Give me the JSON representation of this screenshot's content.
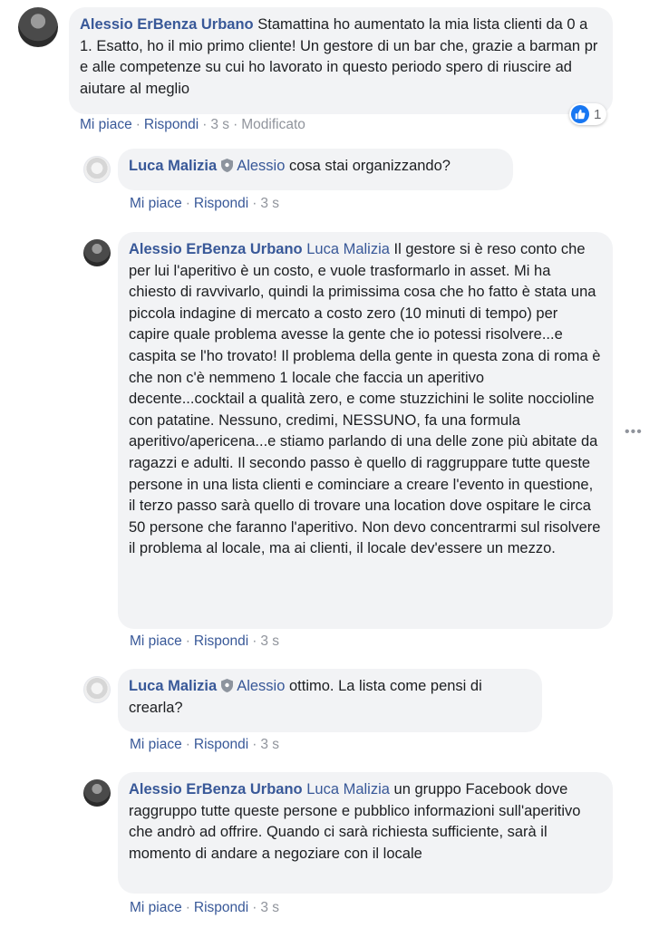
{
  "comments": [
    {
      "author": "Alessio ErBenza Urbano",
      "tag": "",
      "text": "Stamattina ho aumentato la mia lista clienti da 0 a 1. Esatto, ho il mio primo cliente! Un gestore di un bar che, grazie a barman pr e alle competenze su cui ho lavorato in questo periodo spero di riuscire ad aiutare al meglio",
      "like_label": "Mi piace",
      "reply_label": "Rispondi",
      "time": "3 s",
      "edited": "Modificato",
      "reaction_count": "1"
    },
    {
      "author": "Luca Malizia",
      "tag": "Alessio",
      "text": "cosa stai organizzando?",
      "like_label": "Mi piace",
      "reply_label": "Rispondi",
      "time": "3 s"
    },
    {
      "author": "Alessio ErBenza Urbano",
      "tag": "Luca Malizia",
      "text": "Il gestore si è reso conto che per lui l'aperitivo è un costo, e vuole trasformarlo in asset. Mi ha chiesto di ravvivarlo, quindi la primissima cosa che ho fatto è stata una piccola indagine di mercato a costo zero (10 minuti di tempo) per capire quale problema avesse la gente che io potessi risolvere...e caspita se l'ho trovato! Il problema della gente in questa zona di roma è che non c'è nemmeno 1 locale che faccia un aperitivo decente...cocktail a qualità zero, e come stuzzichini le solite noccioline con patatine. Nessuno, credimi, NESSUNO, fa una formula aperitivo/apericena...e stiamo parlando di una delle zone più abitate da ragazzi e adulti. Il secondo passo è quello di raggruppare tutte queste persone in una lista clienti e cominciare a creare l'evento in questione, il terzo passo sarà quello di trovare una location dove ospitare le circa 50 persone che faranno l'aperitivo. Non devo concentrarmi sul risolvere il problema al locale, ma ai clienti, il locale dev'essere un mezzo.",
      "like_label": "Mi piace",
      "reply_label": "Rispondi",
      "time": "3 s"
    },
    {
      "author": "Luca Malizia",
      "tag": "Alessio",
      "text": "ottimo. La lista come pensi di crearla?",
      "like_label": "Mi piace",
      "reply_label": "Rispondi",
      "time": "3 s"
    },
    {
      "author": "Alessio ErBenza Urbano",
      "tag": "Luca Malizia",
      "text": "un gruppo Facebook dove raggruppo tutte queste persone e pubblico informazioni sull'aperitivo che andrò ad offrire. Quando ci sarà richiesta sufficiente, sarà il momento di andare a negoziare con il locale",
      "like_label": "Mi piace",
      "reply_label": "Rispondi",
      "time": "3 s"
    }
  ],
  "more_options_icon": "more-horizontal-icon",
  "colors": {
    "link": "#385898",
    "bubble": "#f2f3f5",
    "meta": "#90949c",
    "like_blue": "#1877f2"
  }
}
